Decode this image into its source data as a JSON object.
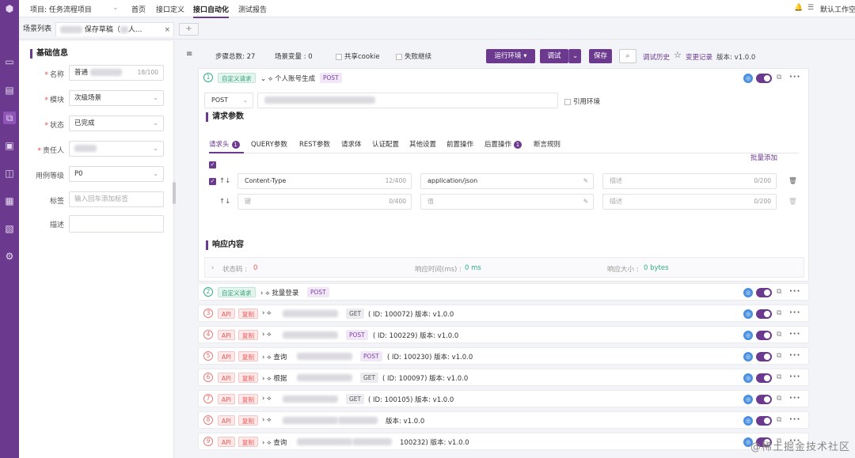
{
  "topbar": {
    "project": "项目: 任务流程项目",
    "nav": [
      "首页",
      "接口定义",
      "接口自动化",
      "测试报告"
    ],
    "active": "接口自动化",
    "workspace": "默认工作空间"
  },
  "tabs": {
    "list": "场景列表",
    "draft": "保存草稿（",
    "draft_suffix": "人...",
    "add": "+"
  },
  "panel": {
    "section": "基础信息",
    "name_label": "名称",
    "name_value": "普通",
    "name_count": "18/100",
    "module_label": "模块",
    "module_value": "次级场景",
    "status_label": "状态",
    "status_value": "已完成",
    "owner_label": "责任人",
    "level_label": "用例等级",
    "level_value": "P0",
    "tags_label": "标签",
    "tags_placeholder": "输入回车添加标签",
    "desc_label": "描述"
  },
  "toolbar": {
    "steps": "步骤总数: 27",
    "vars": "场景变量 : 0",
    "share_cookie": "共享cookie",
    "fail_continue": "失败继续",
    "env": "运行环境",
    "debug": "调试",
    "save": "保存",
    "history": "调试历史",
    "changes": "变更记录",
    "version": "版本: v1.0.0"
  },
  "card": {
    "num": "1",
    "tag": "自定义请求",
    "title": "个人账号生成",
    "method": "POST",
    "method_select": "POST",
    "use_env": "引用环境",
    "params_title": "请求参数",
    "subtabs": [
      "请求头",
      "QUERY参数",
      "REST参数",
      "请求体",
      "认证配置",
      "其他设置",
      "前置操作",
      "后置操作",
      "断言规则"
    ],
    "header_badge": "1",
    "post_badge": "1",
    "bulk_add": "批量添加",
    "row1_key": "Content-Type",
    "row1_key_count": "12/400",
    "row1_val": "application/json",
    "row1_desc": "描述",
    "row1_desc_count": "0/200",
    "row2_key": "键",
    "row2_key_count": "0/400",
    "row2_val": "值",
    "row2_desc": "描述",
    "row2_desc_count": "0/200",
    "resp_title": "响应内容",
    "status_code": "状态码 :",
    "status_val": "0",
    "resp_time": "响应时间(ms) :",
    "resp_time_val": "0 ms",
    "resp_size": "响应大小 :",
    "resp_size_val": "0 bytes"
  },
  "steps": [
    {
      "num": "2",
      "kind": "自定义请求",
      "title": "批量登录",
      "method": "POST",
      "info": ""
    },
    {
      "num": "3",
      "kind": "API",
      "copy": "复制",
      "title": "",
      "method": "GET",
      "info": "( ID: 100072)  版本: v1.0.0"
    },
    {
      "num": "4",
      "kind": "API",
      "copy": "复制",
      "title": "",
      "method": "POST",
      "info": "( ID: 100229)  版本: v1.0.0"
    },
    {
      "num": "5",
      "kind": "API",
      "copy": "复制",
      "title": "查询",
      "method": "POST",
      "info": "( ID: 100230)  版本: v1.0.0"
    },
    {
      "num": "6",
      "kind": "API",
      "copy": "复制",
      "title": "根据",
      "method": "GET",
      "info": "( ID: 100097)  版本: v1.0.0"
    },
    {
      "num": "7",
      "kind": "API",
      "copy": "复制",
      "title": "",
      "method": "GET",
      "info": "( ID: 100105)  版本: v1.0.0"
    },
    {
      "num": "8",
      "kind": "API",
      "copy": "复制",
      "title": "",
      "method": "",
      "info": "版本: v1.0.0"
    },
    {
      "num": "9",
      "kind": "API",
      "copy": "复制",
      "title": "查询",
      "method": "",
      "info": "100232)  版本: v1.0.0"
    }
  ],
  "watermark": "@稀土掘金技术社区"
}
